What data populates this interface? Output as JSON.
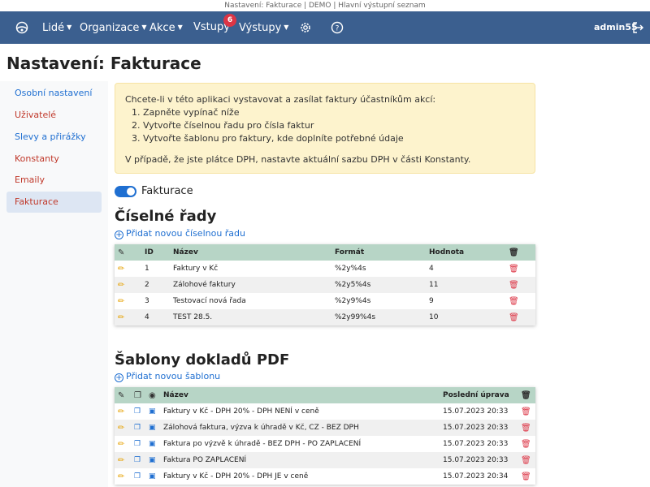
{
  "window_title": "Nastavení: Fakturace | DEMO | Hlavní výstupní seznam",
  "nav": {
    "people": "Lidé",
    "organizations": "Organizace",
    "events": "Akce",
    "inputs": "Vstupy",
    "inputs_badge": "6",
    "outputs": "Výstupy",
    "user": "admin55"
  },
  "page_title": "Nastavení: Fakturace",
  "sidebar": {
    "items": [
      {
        "label": "Osobní nastavení"
      },
      {
        "label": "Uživatelé"
      },
      {
        "label": "Slevy a přirážky"
      },
      {
        "label": "Konstanty"
      },
      {
        "label": "Emaily"
      },
      {
        "label": "Fakturace"
      }
    ]
  },
  "alert": {
    "intro": "Chcete-li v této aplikaci vystavovat a zasílat faktury účastníkům akcí:",
    "steps": [
      "Zapněte vypínač níže",
      "Vytvořte číselnou řadu pro čísla faktur",
      "Vytvořte šablonu pro faktury, kde doplníte potřebné údaje"
    ],
    "note": "V případě, že jste plátce DPH, nastavte aktuální sazbu DPH v části Konstanty."
  },
  "toggle": {
    "label": "Fakturace",
    "enabled": true
  },
  "series": {
    "title": "Číselné řady",
    "add_link": "Přidat novou číselnou řadu",
    "columns": {
      "id": "ID",
      "name": "Název",
      "format": "Formát",
      "value": "Hodnota"
    },
    "rows": [
      {
        "id": "1",
        "name": "Faktury v Kč",
        "format": "%2y%4s",
        "value": "4"
      },
      {
        "id": "2",
        "name": "Zálohové faktury",
        "format": "%2y5%4s",
        "value": "11"
      },
      {
        "id": "3",
        "name": "Testovací nová řada",
        "format": "%2y9%4s",
        "value": "9"
      },
      {
        "id": "4",
        "name": "TEST 28.5.",
        "format": "%2y99%4s",
        "value": "10"
      }
    ]
  },
  "templates": {
    "title": "Šablony dokladů PDF",
    "add_link": "Přidat novou šablonu",
    "columns": {
      "name": "Název",
      "modified": "Poslední úprava"
    },
    "rows": [
      {
        "name": "Faktury v Kč - DPH 20% - DPH NENÍ v ceně",
        "modified": "15.07.2023 20:33"
      },
      {
        "name": "Zálohová faktura, výzva k úhradě v Kč, CZ - BEZ DPH",
        "modified": "15.07.2023 20:33"
      },
      {
        "name": "Faktura po výzvě k úhradě - BEZ DPH - PO ZAPLACENÍ",
        "modified": "15.07.2023 20:33"
      },
      {
        "name": "Faktura PO ZAPLACENÍ",
        "modified": "15.07.2023 20:33"
      },
      {
        "name": "Faktury v Kč - DPH 20% - DPH JE v ceně",
        "modified": "15.07.2023 20:34"
      }
    ]
  }
}
